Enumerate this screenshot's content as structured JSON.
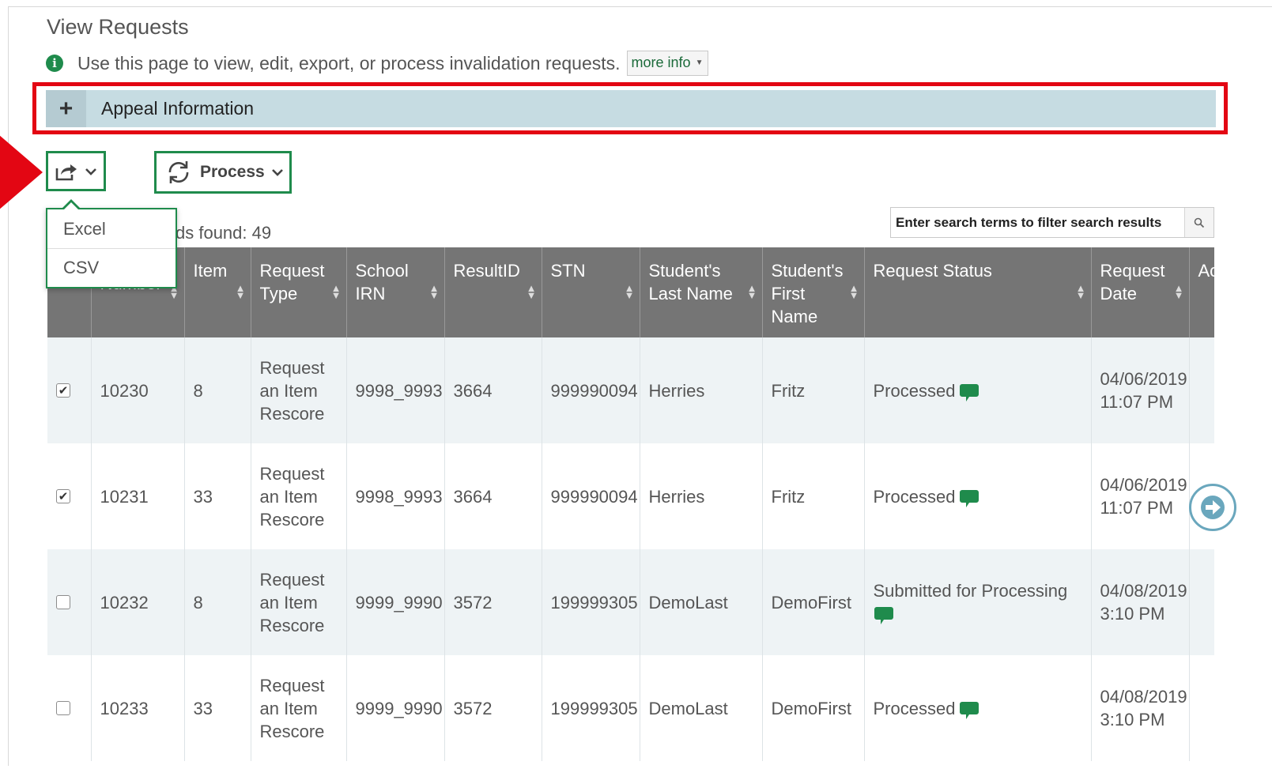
{
  "page": {
    "title": "View Requests",
    "info_text": "Use this page to view, edit, export, or process invalidation requests.",
    "more_info_label": "more info"
  },
  "appeal": {
    "label": "Appeal Information"
  },
  "toolbar": {
    "process_label": "Process",
    "export_menu": [
      "Excel",
      "CSV"
    ]
  },
  "records": {
    "label": "ds found: 49"
  },
  "search": {
    "placeholder": "Enter search terms to filter search results"
  },
  "table": {
    "columns": [
      "",
      "Number",
      "Item",
      "Request Type",
      "School IRN",
      "ResultID",
      "STN",
      "Student's Last Name",
      "Student's First Name",
      "Request Status",
      "Request Date",
      "Ac Co"
    ],
    "rows": [
      {
        "checked": true,
        "number": "10230",
        "item": "8",
        "request_type": "Request an Item Rescore",
        "school_irn": "9998_9993",
        "result_id": "3664",
        "stn": "999990094",
        "last_name": "Herries",
        "first_name": "Fritz",
        "status": "Processed",
        "date": "04/06/2019",
        "time": "11:07 PM"
      },
      {
        "checked": true,
        "number": "10231",
        "item": "33",
        "request_type": "Request an Item Rescore",
        "school_irn": "9998_9993",
        "result_id": "3664",
        "stn": "999990094",
        "last_name": "Herries",
        "first_name": "Fritz",
        "status": "Processed",
        "date": "04/06/2019",
        "time": "11:07 PM"
      },
      {
        "checked": false,
        "number": "10232",
        "item": "8",
        "request_type": "Request an Item Rescore",
        "school_irn": "9999_9990",
        "result_id": "3572",
        "stn": "199999305",
        "last_name": "DemoLast",
        "first_name": "DemoFirst",
        "status": "Submitted for Processing",
        "date": "04/08/2019",
        "time": "3:10 PM"
      },
      {
        "checked": false,
        "number": "10233",
        "item": "33",
        "request_type": "Request an Item Rescore",
        "school_irn": "9999_9990",
        "result_id": "3572",
        "stn": "199999305",
        "last_name": "DemoLast",
        "first_name": "DemoFirst",
        "status": "Processed",
        "date": "04/08/2019",
        "time": "3:10 PM"
      }
    ]
  },
  "colors": {
    "accent_green": "#1f8b4c",
    "highlight_red": "#e30613",
    "header_gray": "#757575",
    "appeal_bar": "#c6dce2"
  }
}
